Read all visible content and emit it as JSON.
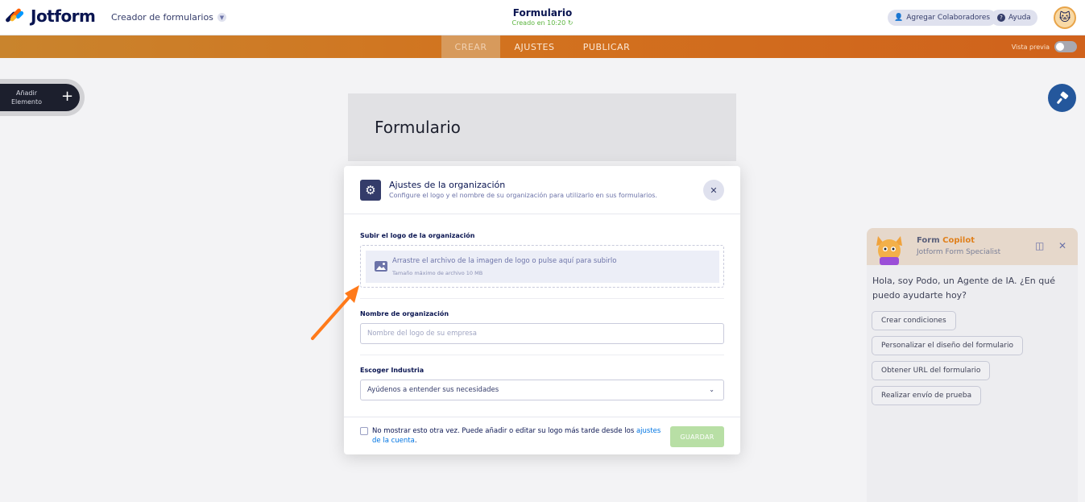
{
  "topbar": {
    "logo_text": "Jotform",
    "builder_label": "Creador de formularios",
    "form_title": "Formulario",
    "form_subtitle": "Creado en 10:20",
    "collab_label": "Agregar Colaboradores",
    "help_label": "Ayuda"
  },
  "nav": {
    "tabs": [
      "CREAR",
      "AJUSTES",
      "PUBLICAR"
    ],
    "active_tab": "CREAR",
    "preview_label": "Vista previa",
    "preview_on": false
  },
  "sidebar": {
    "add_element_label_1": "Añadir",
    "add_element_label_2": "Elemento"
  },
  "form_card": {
    "title": "Formulario"
  },
  "copilot": {
    "name_prefix": "Form ",
    "name_accent": "Copilot",
    "subtitle": "Jotform Form Specialist",
    "message": "Hola, soy Podo, un Agente de IA. ¿En qué puedo ayudarte hoy?",
    "chips": [
      "Crear condiciones",
      "Personalizar el diseño del formulario",
      "Obtener URL del formulario",
      "Realizar envío de prueba"
    ]
  },
  "modal": {
    "title": "Ajustes de la organización",
    "subtitle": "Configure el logo y el nombre de su organización para utilizarlo en sus formularios.",
    "upload_label": "Subir el logo de la organización",
    "upload_text": "Arrastre el archivo de la imagen de logo o pulse aquí para subirlo",
    "upload_sub": "Tamaño máximo de archivo 10 MB",
    "org_name_label": "Nombre de organización",
    "org_name_placeholder": "Nombre del logo de su empresa",
    "industry_label": "Escoger Industria",
    "industry_value": "Ayúdenos a entender sus necesidades",
    "footer_text": "No mostrar esto otra vez. Puede añadir o editar su logo más tarde desde los ",
    "footer_link": "ajustes de la cuenta",
    "footer_end": ".",
    "save_label": "GUARDAR"
  },
  "colors": {
    "brand_navy": "#0a1551",
    "nav_orange": "#d2731f",
    "save_green": "#b8dfa5",
    "link_blue": "#0075e3",
    "annotation_arrow": "#ff7a1a"
  }
}
